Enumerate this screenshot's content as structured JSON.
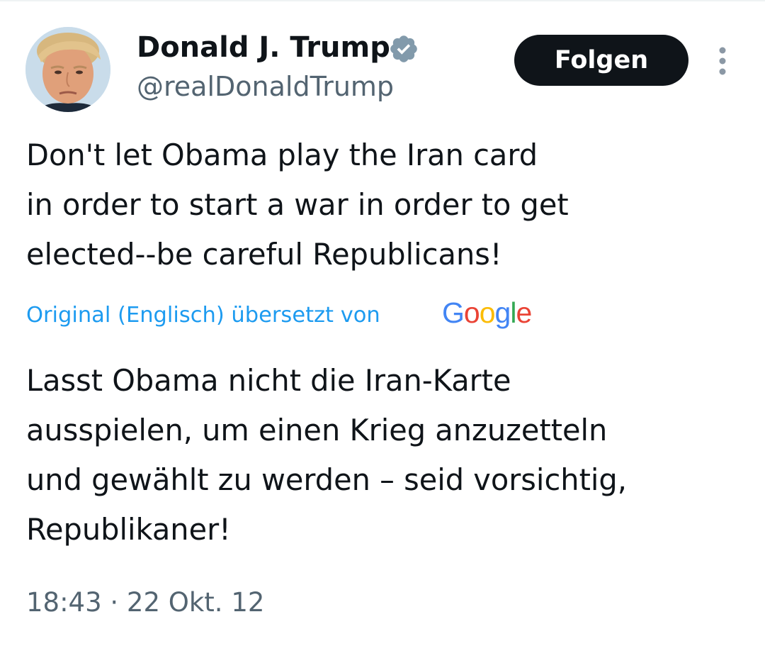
{
  "author": {
    "display_name": "Donald J. Trump",
    "handle": "@realDonaldTrump",
    "verified": true
  },
  "actions": {
    "follow_label": "Folgen"
  },
  "tweet": {
    "text": "Don't let Obama play the Iran card\nin order to start a war in order to get\nelected--be careful Republicans!",
    "translation_note": "Original (Englisch) übersetzt von",
    "translation_provider": "Google",
    "translated_text": "Lasst Obama nicht die Iran-Karte\nausspielen, um einen Krieg anzuzetteln\nund gewählt zu werden – seid vorsichtig,\nRepublikaner!",
    "timestamp": "18:43 · 22 Okt. 12"
  },
  "icons": {
    "verified": "verified-badge-icon",
    "more": "more-vertical-icon"
  },
  "colors": {
    "text": "#0f1419",
    "secondary_text": "#536471",
    "link": "#1d9bf0",
    "follow_button_bg": "#0f1419",
    "verified_badge": "#829aab"
  }
}
